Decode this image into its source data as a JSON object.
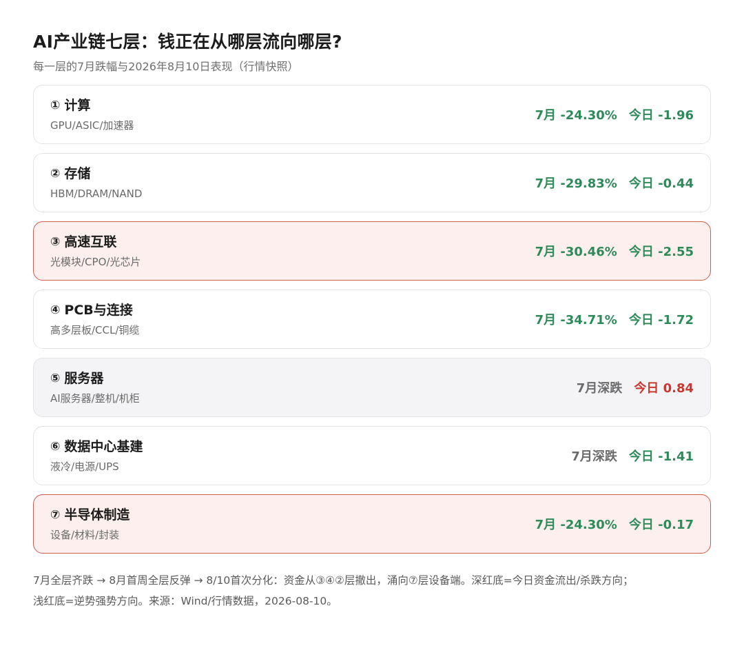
{
  "header": {
    "title": "AI产业链七层：钱正在从哪层流向哪层?",
    "subtitle": "每一层的7月跌幅与2026年8月10日表现（行情快照）"
  },
  "layers": [
    {
      "num": "①",
      "name": "计算",
      "desc": "GPU/ASIC/加速器",
      "july": "7月 -24.30%",
      "today": "今日 -1.96",
      "style": "normal",
      "july_color": "green",
      "today_color": "green"
    },
    {
      "num": "②",
      "name": "存储",
      "desc": "HBM/DRAM/NAND",
      "july": "7月 -29.83%",
      "today": "今日 -0.44",
      "style": "normal",
      "july_color": "green",
      "today_color": "green"
    },
    {
      "num": "③",
      "name": "高速互联",
      "desc": "光模块/CPO/光芯片",
      "july": "7月 -30.46%",
      "today": "今日 -2.55",
      "style": "highlight",
      "july_color": "green",
      "today_color": "green"
    },
    {
      "num": "④",
      "name": "PCB与连接",
      "desc": "高多层板/CCL/铜缆",
      "july": "7月 -34.71%",
      "today": "今日 -1.72",
      "style": "normal",
      "july_color": "green",
      "today_color": "green"
    },
    {
      "num": "⑤",
      "name": "服务器",
      "desc": "AI服务器/整机/机柜",
      "july": "7月深跌",
      "today": "今日 0.84",
      "style": "muted",
      "july_color": "gray",
      "today_color": "red"
    },
    {
      "num": "⑥",
      "name": "数据中心基建",
      "desc": "液冷/电源/UPS",
      "july": "7月深跌",
      "today": "今日 -1.41",
      "style": "normal",
      "july_color": "gray",
      "today_color": "green"
    },
    {
      "num": "⑦",
      "name": "半导体制造",
      "desc": "设备/材料/封装",
      "july": "7月 -24.30%",
      "today": "今日 -0.17",
      "style": "highlight",
      "july_color": "green",
      "today_color": "green"
    }
  ],
  "footnote": {
    "line1": "7月全层齐跌 → 8月首周全层反弹 → 8/10首次分化：资金从③④②层撤出，涌向⑦层设备端。深红底=今日资金流出/杀跌方向；",
    "line2": "浅红底=逆势强势方向。来源：Wind/行情数据，2026-08-10。"
  },
  "colors": {
    "down_green": "#2f8a5a",
    "up_red": "#c8382e",
    "neutral_gray": "#6b6b6b",
    "highlight_bg": "#fcefed",
    "highlight_border": "#cf5a50",
    "muted_bg": "#f4f4f6"
  }
}
